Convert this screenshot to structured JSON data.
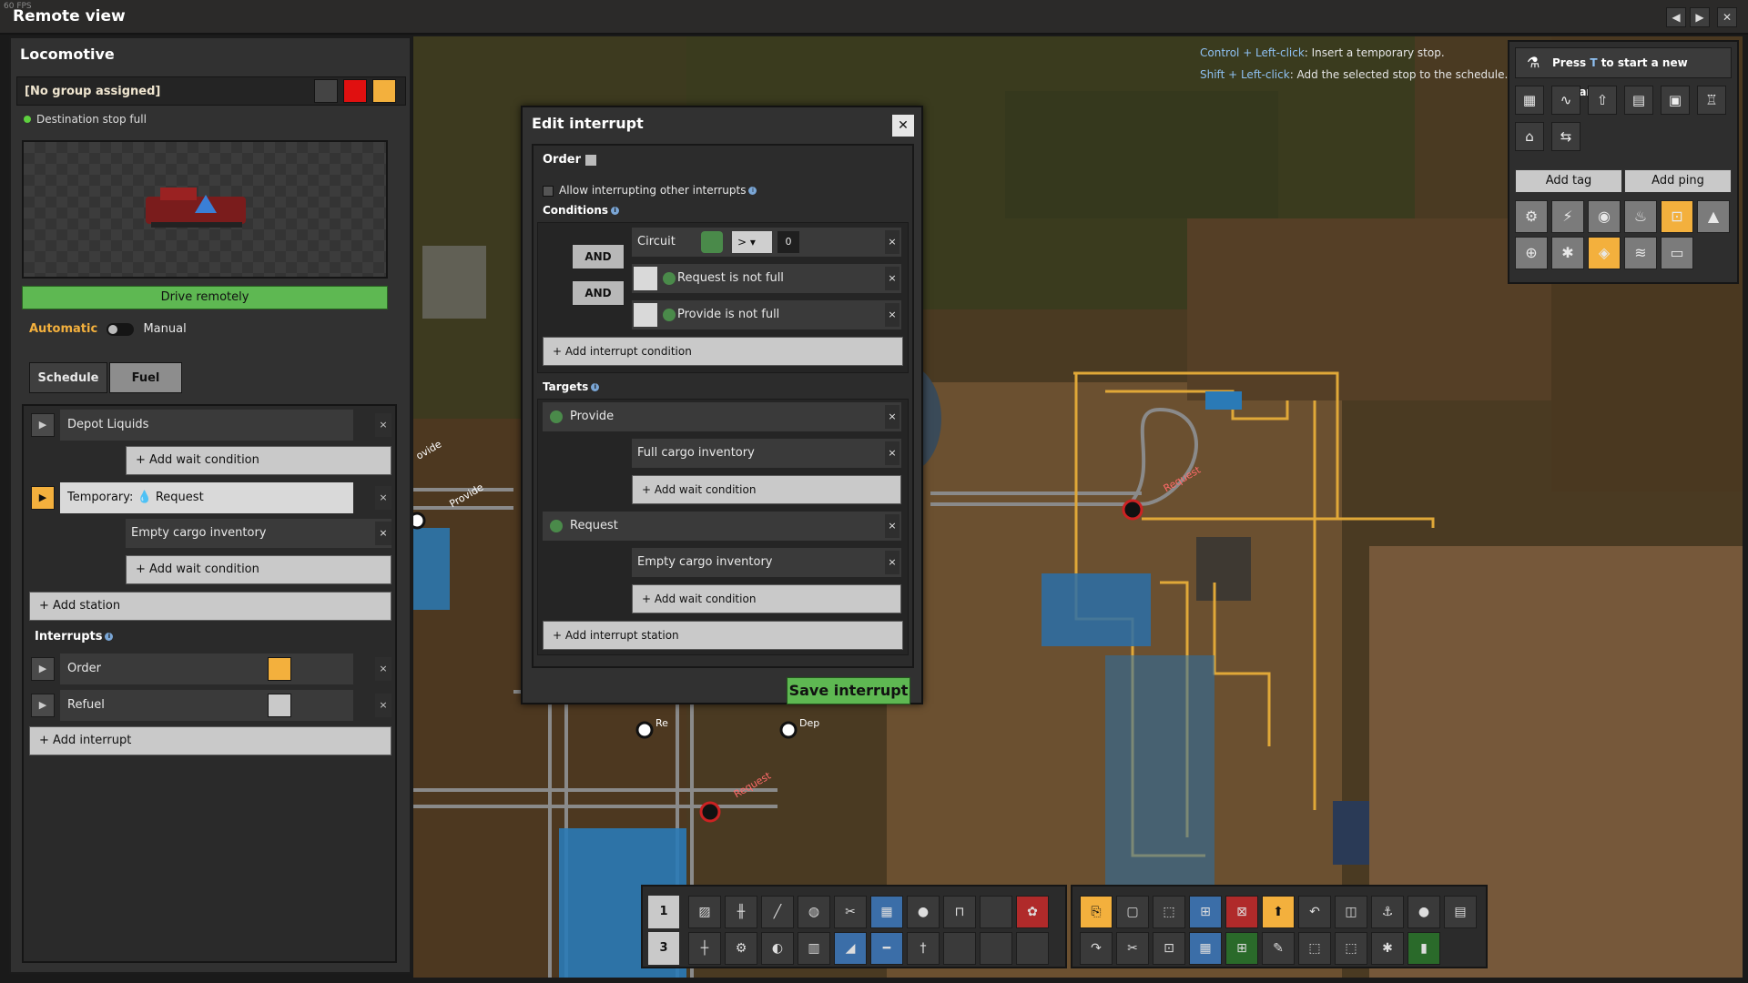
{
  "window": {
    "fps": "60 FPS",
    "title": "Remote view",
    "nav_prev": "◀",
    "nav_next": "▶",
    "close": "✕"
  },
  "locomotive": {
    "title": "Locomotive",
    "group": "[No group assigned]",
    "status": "Destination stop full",
    "drive_button": "Drive remotely",
    "mode_automatic": "Automatic",
    "mode_manual": "Manual",
    "tabs": [
      "Schedule",
      "Fuel"
    ]
  },
  "schedule": {
    "stations": [
      {
        "name": "Depot Liquids"
      },
      {
        "name": "Request",
        "prefix": "Temporary:"
      }
    ],
    "wait_condition_empty": "Empty cargo inventory",
    "add_wait": "+ Add wait condition",
    "add_station": "+ Add station",
    "interrupts_label": "Interrupts",
    "interrupts": [
      "Order",
      "Refuel"
    ],
    "add_interrupt": "+ Add interrupt"
  },
  "dialog": {
    "title": "Edit interrupt",
    "name": "Order",
    "allow_label": "Allow interrupting other interrupts",
    "conditions_label": "Conditions",
    "circuit": {
      "label": "Circuit",
      "operator": ">",
      "value": "0"
    },
    "and_label": "AND",
    "conditions": [
      "Request is not full",
      "Provide is not full"
    ],
    "add_condition": "+ Add interrupt condition",
    "targets_label": "Targets",
    "targets": [
      {
        "name": "Provide",
        "condition": "Full cargo inventory"
      },
      {
        "name": "Request",
        "condition": "Empty cargo inventory"
      }
    ],
    "add_wait": "+ Add wait condition",
    "add_station": "+ Add interrupt station",
    "save": "Save interrupt",
    "close": "✕"
  },
  "hints": {
    "line1_key": "Control + Left-click",
    "line1_text": ": Insert a temporary stop.",
    "line2_key": "Shift + Left-click",
    "line2_text": ": Add the selected stop to the schedule."
  },
  "right_panel": {
    "research_prefix": "Press ",
    "research_key": "T",
    "research_suffix": " to start a new research.",
    "add_tag": "Add tag",
    "add_ping": "Add ping"
  },
  "map_labels": {
    "provide": "Provide",
    "request": "Request",
    "request2": "Request",
    "provide_edge": "ovide",
    "re": "Re",
    "dep": "Dep"
  },
  "quickbar": {
    "rows": [
      "1",
      "3"
    ]
  },
  "colors": {
    "accent_green": "#5eb852",
    "accent_orange": "#f3b03d",
    "hint_blue": "#8fc1f3",
    "rail_yellow": "#e0a838"
  }
}
